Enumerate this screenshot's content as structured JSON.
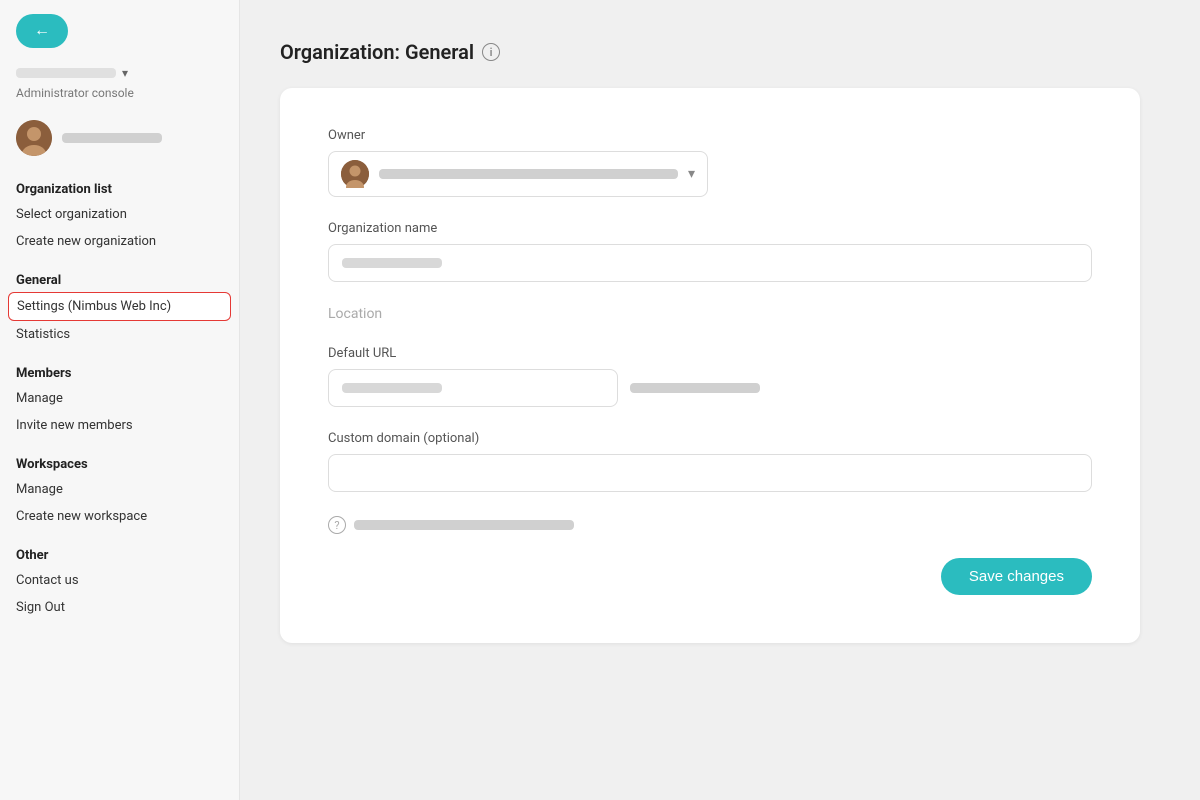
{
  "sidebar": {
    "back_button": "←",
    "org_selector_placeholder": "",
    "admin_console": "Administrator console",
    "sections": [
      {
        "title": "Organization list",
        "items": [
          {
            "label": "Select organization",
            "active": false,
            "id": "select-org"
          },
          {
            "label": "Create new organization",
            "active": false,
            "id": "create-org"
          }
        ]
      },
      {
        "title": "General",
        "items": [
          {
            "label": "Settings (Nimbus Web Inc)",
            "active": true,
            "id": "settings"
          },
          {
            "label": "Statistics",
            "active": false,
            "id": "statistics"
          }
        ]
      },
      {
        "title": "Members",
        "items": [
          {
            "label": "Manage",
            "active": false,
            "id": "members-manage"
          },
          {
            "label": "Invite new members",
            "active": false,
            "id": "invite-members"
          }
        ]
      },
      {
        "title": "Workspaces",
        "items": [
          {
            "label": "Manage",
            "active": false,
            "id": "workspaces-manage"
          },
          {
            "label": "Create new workspace",
            "active": false,
            "id": "create-workspace"
          }
        ]
      },
      {
        "title": "Other",
        "items": [
          {
            "label": "Contact us",
            "active": false,
            "id": "contact-us"
          },
          {
            "label": "Sign Out",
            "active": false,
            "id": "sign-out"
          }
        ]
      }
    ]
  },
  "main": {
    "page_title": "Organization: General",
    "form": {
      "owner_label": "Owner",
      "org_name_label": "Organization name",
      "location_label": "Location",
      "default_url_label": "Default URL",
      "custom_domain_label": "Custom domain (optional)",
      "save_button": "Save changes"
    }
  }
}
